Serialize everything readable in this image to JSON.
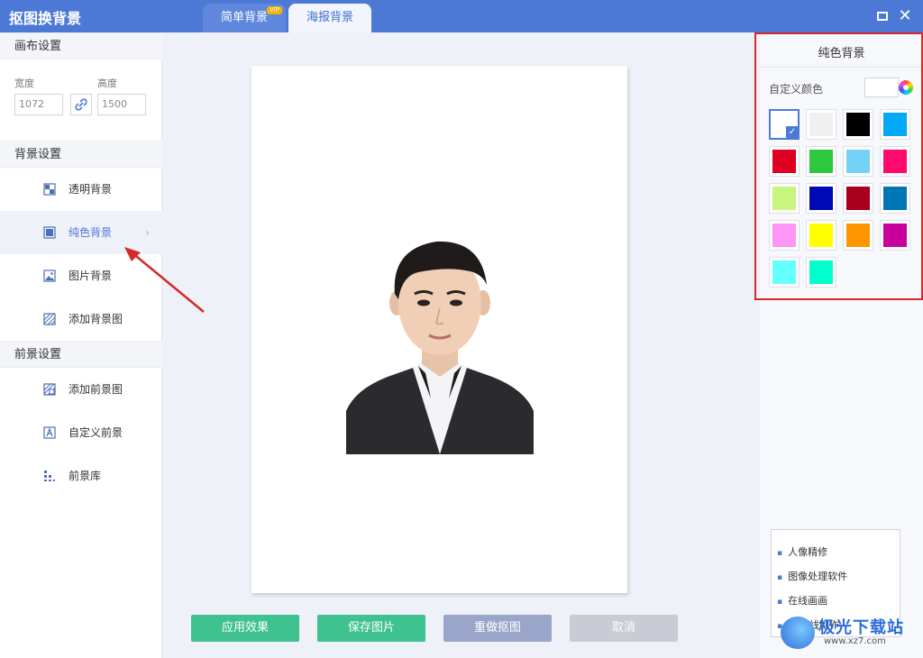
{
  "app": {
    "title": "抠图换背景"
  },
  "tabs": [
    {
      "label": "简单背景",
      "badge": "VIP"
    },
    {
      "label": "海报背景"
    }
  ],
  "canvas_settings": {
    "header": "画布设置",
    "width_label": "宽度",
    "width_value": "1072",
    "height_label": "高度",
    "height_value": "1500"
  },
  "background_settings": {
    "header": "背景设置",
    "items": [
      {
        "label": "透明背景",
        "icon": "transparent-bg-icon"
      },
      {
        "label": "纯色背景",
        "icon": "solid-bg-icon",
        "active": true
      },
      {
        "label": "图片背景",
        "icon": "image-bg-icon"
      },
      {
        "label": "添加背景图",
        "icon": "add-bg-image-icon"
      }
    ]
  },
  "foreground_settings": {
    "header": "前景设置",
    "items": [
      {
        "label": "添加前景图",
        "icon": "add-fg-image-icon"
      },
      {
        "label": "自定义前景",
        "icon": "custom-fg-icon"
      },
      {
        "label": "前景库",
        "icon": "fg-library-icon"
      }
    ]
  },
  "actions": {
    "apply": "应用效果",
    "save": "保存图片",
    "redo": "重做抠图",
    "cancel": "取消"
  },
  "right_panel": {
    "title": "纯色背景",
    "custom_color_label": "自定义颜色",
    "swatches": [
      "#ffffff",
      "#f0f0f0",
      "#000000",
      "#03a9f4",
      "#e00022",
      "#2ec83c",
      "#74d2f8",
      "#ff0a6c",
      "#c8f57d",
      "#0009b6",
      "#a8001c",
      "#0076b4",
      "#ff96f5",
      "#ffff00",
      "#ff9600",
      "#c8009c",
      "#64ffff",
      "#00ffcc"
    ]
  },
  "popup": {
    "items": [
      "人像精修",
      "图像处理软件",
      "在线画画",
      "ps在线制作"
    ]
  },
  "watermark": {
    "text": "极光下载站",
    "sub": "www.xz7.com"
  },
  "colors": {
    "accent": "#4d79d6",
    "green": "#3fc28f",
    "highlight": "#d42a2a"
  }
}
